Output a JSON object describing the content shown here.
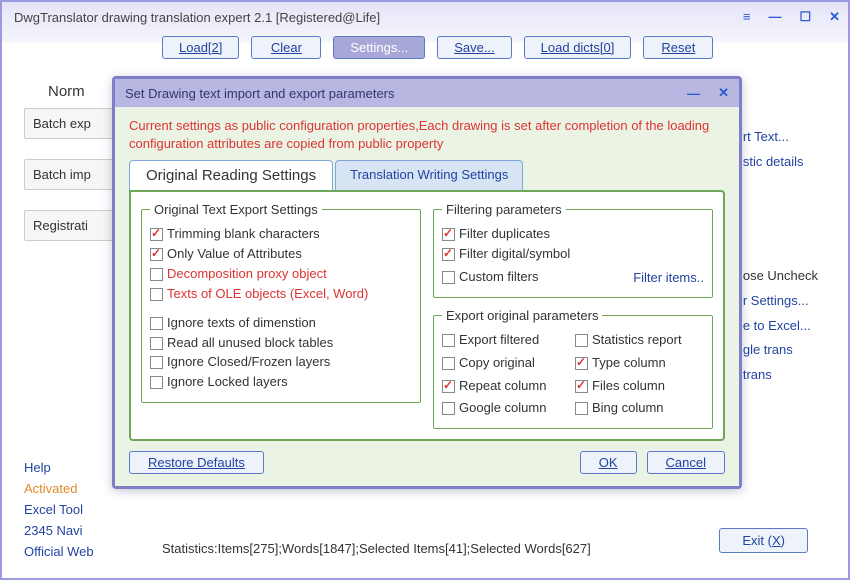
{
  "window_title": "DwgTranslator drawing translation expert 2.1 [Registered@Life]",
  "toolbar": {
    "load": "Load[2]",
    "clear": "Clear",
    "settings": "Settings...",
    "save": "Save...",
    "load_dicts": "Load dicts[0]",
    "reset": "Reset"
  },
  "normal_label": "Norm",
  "side_buttons": {
    "batch_exp": "Batch exp",
    "batch_imp": "Batch imp",
    "registration": "Registrati"
  },
  "links": {
    "help": "Help",
    "activated": "Activated",
    "excel_tool": "Excel Tool",
    "navi": "2345 Navi",
    "official": "Official Web"
  },
  "right_fragments": {
    "rt_text": "rt Text...",
    "stic": "stic details",
    "ose": "ose Uncheck",
    "r_settings": "r Settings...",
    "e_excel": "e to Excel...",
    "gle": "gle trans",
    "trans": " trans"
  },
  "stats_line": "Statistics:Items[275];Words[1847];Selected Items[41];Selected Words[627]",
  "exit_label": "Exit (",
  "exit_key": "X",
  "dialog": {
    "title": "Set Drawing text import and export parameters",
    "warning": "Current settings as public configuration properties,Each drawing is set after completion of the loading configuration attributes are copied from public property",
    "tabs": {
      "reading": "Original Reading Settings",
      "writing": "Translation Writing Settings"
    },
    "grp_export": {
      "legend": "Original Text Export Settings",
      "trimming": "Trimming blank characters",
      "only_val": "Only Value of Attributes",
      "decomp": "Decomposition proxy object",
      "ole": "Texts of OLE objects (Excel, Word)",
      "ign_dim": "Ignore texts of dimenstion",
      "read_unused": "Read all unused block tables",
      "ign_closed": "Ignore Closed/Frozen layers",
      "ign_locked": "Ignore Locked layers"
    },
    "grp_filter": {
      "legend": "Filtering parameters",
      "dup": "Filter duplicates",
      "digital": "Filter digital/symbol",
      "custom": "Custom filters",
      "link": "Filter items.."
    },
    "grp_params": {
      "legend": "Export original parameters",
      "exp_filtered": "Export filtered",
      "stats": "Statistics report",
      "copy": "Copy original",
      "type_col": "Type column",
      "repeat": "Repeat column",
      "files": "Files column",
      "google": "Google column",
      "bing": "Bing column"
    },
    "buttons": {
      "restore": "Restore Defaults",
      "ok": "OK",
      "cancel": "Cancel"
    }
  }
}
